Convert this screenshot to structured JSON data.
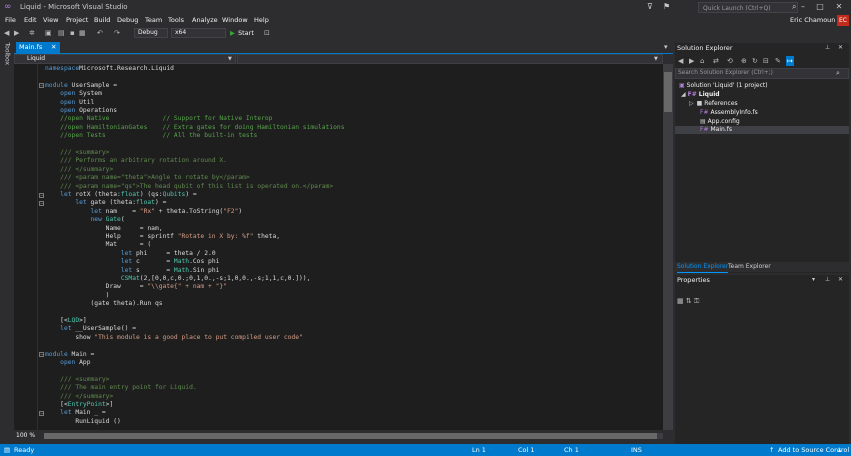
{
  "window": {
    "title": "Liquid - Microsoft Visual Studio",
    "quick_launch_placeholder": "Quick Launch (Ctrl+Q)",
    "user_name": "Eric Chamoun",
    "user_initials": "EC"
  },
  "menu": [
    "File",
    "Edit",
    "View",
    "Project",
    "Build",
    "Debug",
    "Team",
    "Tools",
    "Analyze",
    "Window",
    "Help"
  ],
  "toolbar": {
    "configuration": "Debug",
    "platform": "x64",
    "start_label": "Start"
  },
  "toolbox_label": "Toolbox",
  "document_tab": "Main.fs",
  "navigation_bar": "Liquid",
  "code_lines": [
    [
      [
        "kw",
        "namespace"
      ],
      [
        "",
        "Microsoft.Research.Liquid"
      ]
    ],
    [
      [
        "",
        ""
      ]
    ],
    [
      [
        "kw",
        "module"
      ],
      [
        "",
        " UserSample ="
      ]
    ],
    [
      [
        "",
        "    "
      ],
      [
        "kw",
        "open"
      ],
      [
        "",
        " System"
      ]
    ],
    [
      [
        "",
        "    "
      ],
      [
        "kw",
        "open"
      ],
      [
        "",
        " Util"
      ]
    ],
    [
      [
        "",
        "    "
      ],
      [
        "kw",
        "open"
      ],
      [
        "",
        " Operations"
      ]
    ],
    [
      [
        "",
        "    "
      ],
      [
        "cm",
        "//open Native              // Support for Native Interop"
      ]
    ],
    [
      [
        "",
        "    "
      ],
      [
        "cm",
        "//open HamiltonianGates    // Extra gates for doing Hamiltonian simulations"
      ]
    ],
    [
      [
        "",
        "    "
      ],
      [
        "cm",
        "//open Tests               // All the built-in tests"
      ]
    ],
    [
      [
        "",
        ""
      ]
    ],
    [
      [
        "",
        "    "
      ],
      [
        "xd",
        "/// <summary>"
      ]
    ],
    [
      [
        "",
        "    "
      ],
      [
        "xd",
        "/// Performs an arbitrary rotation around X."
      ]
    ],
    [
      [
        "",
        "    "
      ],
      [
        "xd",
        "/// </summary>"
      ]
    ],
    [
      [
        "",
        "    "
      ],
      [
        "xd",
        "/// <param name=\"theta\">Angle to rotate by</param>"
      ]
    ],
    [
      [
        "",
        "    "
      ],
      [
        "xd",
        "/// <param name=\"qs\">The head qubit of this list is operated on.</param>"
      ]
    ],
    [
      [
        "",
        "    "
      ],
      [
        "kw",
        "let"
      ],
      [
        "",
        " rotX (theta:"
      ],
      [
        "ty",
        "float"
      ],
      [
        "",
        ") (qs:"
      ],
      [
        "ty",
        "Qubits"
      ],
      [
        "",
        ") ="
      ]
    ],
    [
      [
        "",
        "        "
      ],
      [
        "kw",
        "let"
      ],
      [
        "",
        " gate (theta:"
      ],
      [
        "ty",
        "float"
      ],
      [
        "",
        ") ="
      ]
    ],
    [
      [
        "",
        "            "
      ],
      [
        "kw",
        "let"
      ],
      [
        "",
        " nam    = "
      ],
      [
        "st",
        "\"Rx\""
      ],
      [
        "",
        " + theta.ToString("
      ],
      [
        "st",
        "\"F2\""
      ],
      [
        "",
        ")"
      ]
    ],
    [
      [
        "",
        "            "
      ],
      [
        "kw",
        "new"
      ],
      [
        "",
        " "
      ],
      [
        "ty",
        "Gate"
      ],
      [
        "",
        "("
      ]
    ],
    [
      [
        "",
        "                Name     = nam,"
      ]
    ],
    [
      [
        "",
        "                Help     = sprintf "
      ],
      [
        "st",
        "\"Rotate in X by: %f\""
      ],
      [
        "",
        " theta,"
      ]
    ],
    [
      [
        "",
        "                Mat      = ("
      ]
    ],
    [
      [
        "",
        "                    "
      ],
      [
        "kw",
        "let"
      ],
      [
        "",
        " phi     = theta / 2.0"
      ]
    ],
    [
      [
        "",
        "                    "
      ],
      [
        "kw",
        "let"
      ],
      [
        "",
        " c       = "
      ],
      [
        "ty",
        "Math"
      ],
      [
        "",
        ".Cos phi"
      ]
    ],
    [
      [
        "",
        "                    "
      ],
      [
        "kw",
        "let"
      ],
      [
        "",
        " s       = "
      ],
      [
        "ty",
        "Math"
      ],
      [
        "",
        ".Sin phi"
      ]
    ],
    [
      [
        "",
        "                    "
      ],
      [
        "ty",
        "CSMat"
      ],
      [
        "",
        "(2,[0,0,c,0.;0,1,0.,-s;1,0,0.,-s;1,1,c,0.])),"
      ]
    ],
    [
      [
        "",
        "                Draw     = "
      ],
      [
        "st",
        "\"\\\\gate{\" + nam + \"}\""
      ]
    ],
    [
      [
        "",
        "                )"
      ]
    ],
    [
      [
        "",
        "            (gate theta).Run qs"
      ]
    ],
    [
      [
        "",
        ""
      ]
    ],
    [
      [
        "",
        "    [<"
      ],
      [
        "ty",
        "LQD"
      ],
      [
        "",
        ">]"
      ]
    ],
    [
      [
        "",
        "    "
      ],
      [
        "kw",
        "let"
      ],
      [
        "",
        " __UserSample() ="
      ]
    ],
    [
      [
        "",
        "        show "
      ],
      [
        "st",
        "\"This module is a good place to put compiled user code\""
      ]
    ],
    [
      [
        "",
        ""
      ]
    ],
    [
      [
        "kw",
        "module"
      ],
      [
        "",
        " Main ="
      ]
    ],
    [
      [
        "",
        "    "
      ],
      [
        "kw",
        "open"
      ],
      [
        "",
        " App"
      ]
    ],
    [
      [
        "",
        ""
      ]
    ],
    [
      [
        "",
        "    "
      ],
      [
        "xd",
        "/// <summary>"
      ]
    ],
    [
      [
        "",
        "    "
      ],
      [
        "xd",
        "/// The main entry point for Liquid."
      ]
    ],
    [
      [
        "",
        "    "
      ],
      [
        "xd",
        "/// </summary>"
      ]
    ],
    [
      [
        "",
        "    [<"
      ],
      [
        "ty",
        "EntryPoint"
      ],
      [
        "",
        ">]"
      ]
    ],
    [
      [
        "",
        "    "
      ],
      [
        "kw",
        "let"
      ],
      [
        "",
        " Main _ ="
      ]
    ],
    [
      [
        "",
        "        RunLiquid ()"
      ]
    ]
  ],
  "zoom": "100 %",
  "solution_explorer": {
    "title": "Solution Explorer",
    "search_placeholder": "Search Solution Explorer (Ctrl+;)",
    "solution_label": "Solution 'Liquid' (1 project)",
    "project": "Liquid",
    "references": "References",
    "files": [
      "AssemblyInfo.fs",
      "App.config",
      "Main.fs"
    ],
    "tab_solution": "Solution Explorer",
    "tab_team": "Team Explorer"
  },
  "properties": {
    "title": "Properties"
  },
  "status": {
    "ready": "Ready",
    "line": "Ln 1",
    "col": "Col 1",
    "ch": "Ch 1",
    "mode": "INS",
    "source_control": "Add to Source Control"
  },
  "colors": {
    "accent": "#007acc",
    "editor_bg": "#1e1e1e",
    "chrome_bg": "#2d2d30",
    "keyword": "#569cd6",
    "comment": "#57a64a",
    "string": "#d69d85",
    "type": "#4ec9b0"
  }
}
